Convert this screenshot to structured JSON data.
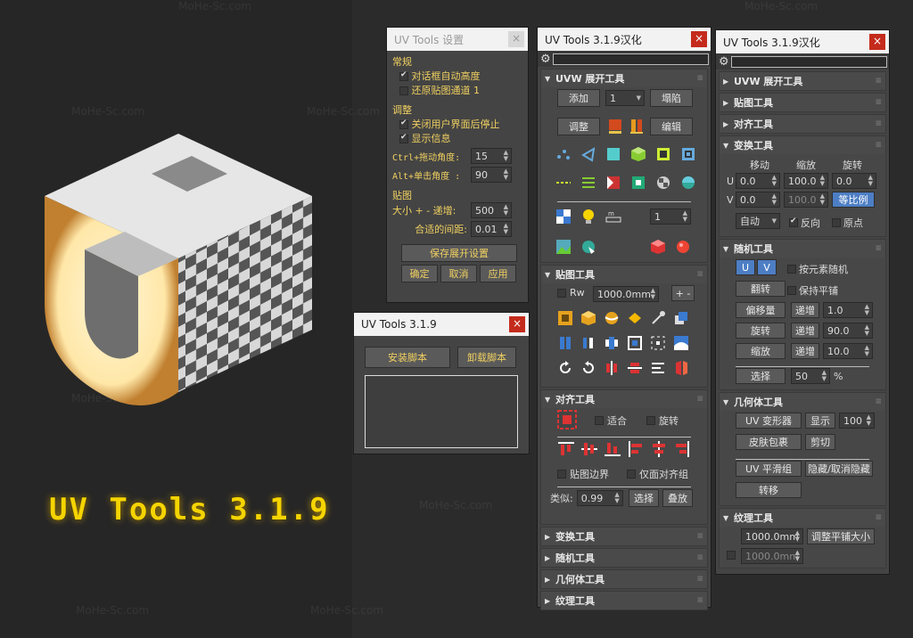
{
  "watermark": "MoHe-Sc.com",
  "brand_title": "UV Tools 3.1.9",
  "settings_window": {
    "title": "UV Tools 设置",
    "close": "×",
    "groups": {
      "general": "常规",
      "auto_height": "对话框自动高度",
      "restore_channel": "还原贴图通道",
      "restore_channel_value": "1",
      "adjust": "调整",
      "close_after_ui": "关闭用户界面后停止",
      "show_info": "显示信息",
      "ctrl_drag": "Ctrl+拖动角度:",
      "ctrl_drag_value": "15",
      "alt_click": "Alt+单击角度 :",
      "alt_click_value": "90",
      "texture": "贴图",
      "size_step": "大小 + - 递增:",
      "size_step_value": "500",
      "fit_margin": "合适的间距:",
      "fit_margin_value": "0.01"
    },
    "save_unwrap": "保存展开设置",
    "ok": "确定",
    "cancel": "取消",
    "apply": "应用"
  },
  "installer_window": {
    "title": "UV Tools 3.1.9",
    "close": "×",
    "install": "安装脚本",
    "uninstall": "卸载脚本"
  },
  "main_window": {
    "title": "UV Tools 3.1.9汉化",
    "close": "×",
    "uvw": {
      "header": "UVW 展开工具",
      "add": "添加",
      "channel": "1",
      "collapse": "塌陷",
      "adjust": "调整",
      "edit": "编辑",
      "spin_value": "1"
    },
    "texture": {
      "header": "贴图工具",
      "rw": "Rw",
      "size": "1000.0mm",
      "plusminus": "+ -"
    },
    "align": {
      "header": "对齐工具",
      "fit": "适合",
      "rotate": "旋转",
      "map_border": "贴图边界",
      "only_align_group": "仅面对齐组",
      "similar": "类似:",
      "similar_value": "0.99",
      "select": "选择",
      "stack": "叠放"
    },
    "collapsed": [
      "变换工具",
      "随机工具",
      "几何体工具",
      "纹理工具"
    ]
  },
  "right_window": {
    "title": "UV Tools 3.1.9汉化",
    "close": "×",
    "collapsed_top": [
      "UVW 展开工具",
      "贴图工具",
      "对齐工具"
    ],
    "transform": {
      "header": "变换工具",
      "move": "移动",
      "scale": "缩放",
      "rotate": "旋转",
      "u": "U",
      "v": "V",
      "u_move": "0.0",
      "u_scale": "100.0",
      "u_rot": "0.0",
      "v_move": "0.0",
      "v_scale": "100.0",
      "proportional": "等比例",
      "auto": "自动",
      "reverse": "反向",
      "origin": "原点"
    },
    "random": {
      "header": "随机工具",
      "u": "U",
      "v": "V",
      "by_element": "按元素随机",
      "flip": "翻转",
      "keep_tiling": "保持平铺",
      "offset": "偏移量",
      "increment": "递增",
      "offset_value": "1.0",
      "rotate": "旋转",
      "rotate_value": "90.0",
      "scale": "缩放",
      "scale_value": "10.0",
      "select": "选择",
      "select_value": "50",
      "percent": "%"
    },
    "geometry": {
      "header": "几何体工具",
      "uv_deform": "UV 变形器",
      "show": "显示",
      "show_value": "100",
      "skin_wrap": "皮肤包裹",
      "cut": "剪切",
      "uv_smooth": "UV 平滑组",
      "hide_unhide": "隐藏/取消隐藏",
      "transfer": "转移"
    },
    "textures": {
      "header": "纹理工具",
      "size": "1000.0mm",
      "adjust_tiling": "调整平铺大小",
      "size2": "1000.0mm"
    }
  }
}
